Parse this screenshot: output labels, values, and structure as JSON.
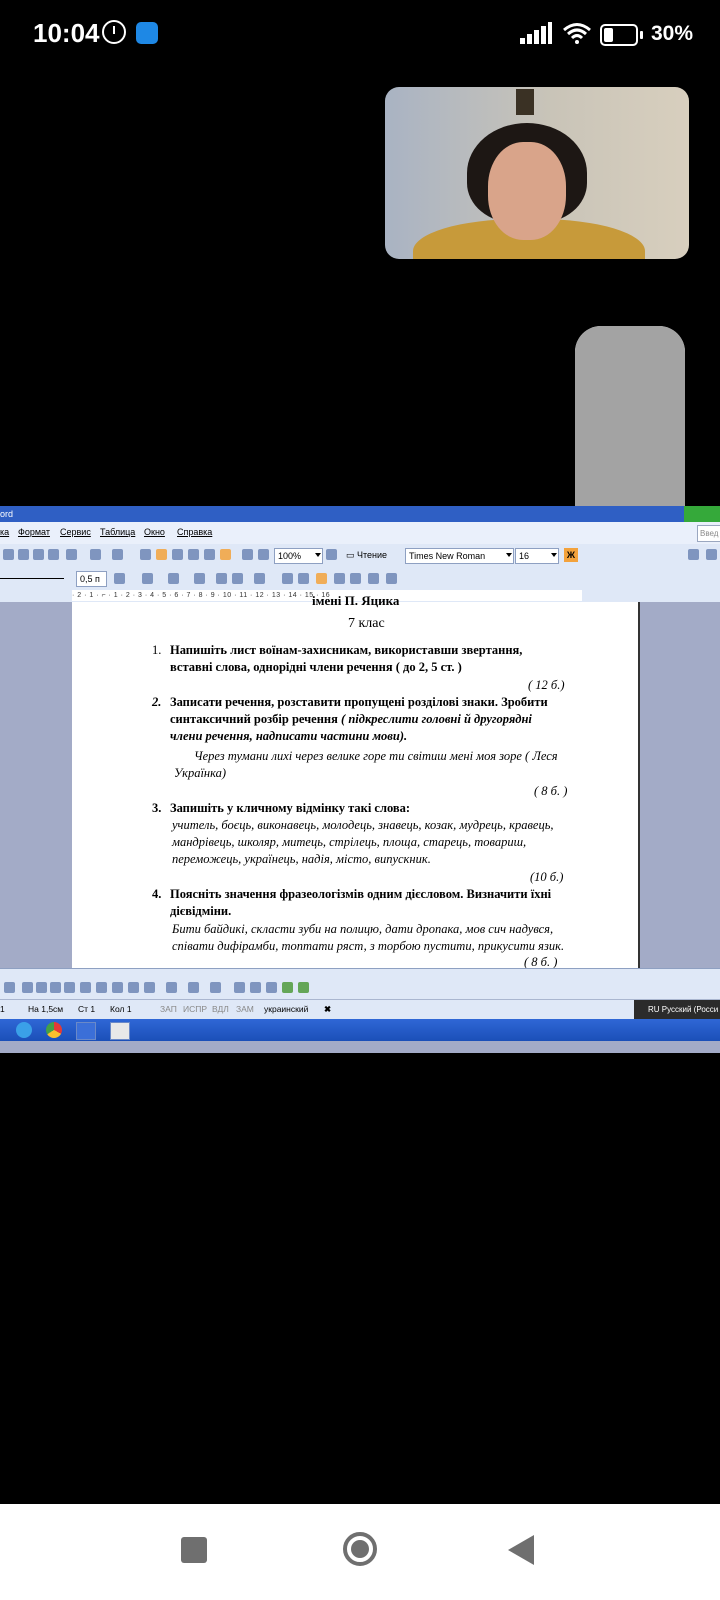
{
  "status_bar": {
    "time": "10:04",
    "battery_percent": "30%",
    "battery_level": 0.3
  },
  "volume_level": 0.27,
  "word": {
    "title": "ord",
    "menu": [
      "ка",
      "Формат",
      "Сервис",
      "Таблица",
      "Окно",
      "Справка"
    ],
    "search_placeholder": "Введ",
    "zoom": "100%",
    "read_label": "Чтение",
    "font": "Times New Roman",
    "font_size": "16",
    "bold_label": "Ж",
    "line_width": "0,5 п",
    "ruler": "· 2 · 1 · ⌐ · 1 · 2 · 3 · 4 · 5 · 6 · 7 · 8 · 9 · 10 · 11 · 12 · 13 · 14 · 15 · 16",
    "document": {
      "cutoff_title": "імені П. Яцика",
      "grade": "7 клас",
      "tasks": [
        {
          "num": "1.",
          "lines": [
            "Напишіть   лист воїнам-захисникам, використавши звертання,",
            "вставні слова, однорідні члени речення ( до  2, 5 ст. )"
          ],
          "score": "( 12 б.)"
        },
        {
          "num": "2.",
          "line1": "Записати речення, розставити пропущені розділові знаки. Зробити",
          "line2_bold": "синтаксичний  розбір  речення ",
          "line2_italic": "( підкреслити  головні й другорядні",
          "line3": "члени речення, надписати  частини мови).",
          "example": [
            "Через тумани лихі через  велике горе  ти  світиш мені  моя зоре ( Леся",
            "Українка)"
          ],
          "score": "( 8 б. )"
        },
        {
          "num": "3.",
          "lines": [
            "Запишіть  у кличному відмінку такі слова:"
          ],
          "words": [
            "учитель, боєць, виконавець, молодець, знавець, козак, мудрець, кравець,",
            "мандрівець, школяр, митець, стрілець, площа, старець, товариш,",
            "переможець, українець,  надія,  місто,  випускник."
          ],
          "score": "(10 б.)"
        },
        {
          "num": "4.",
          "lines": [
            "Поясніть значення  фразеологізмів одним  дієсловом.  Визначити їхні",
            "дієвідміни."
          ],
          "idioms": [
            "Бити байдикі, скласти зуби на полицю, дати дропака, мов сич надувся,",
            "співати дифірамби,  топтати ряст, з торбою пустити, прикусити язик."
          ],
          "score": "(  8 б. )"
        }
      ]
    },
    "status": {
      "page_pos": "1",
      "at": "На 1,5см",
      "line": "Ст 1",
      "col": "Кол 1",
      "rec": "ЗАП",
      "trk": "ИСПР",
      "ext": "ВДЛ",
      "ovr": "ЗАМ",
      "lang": "украинский",
      "langbar": "RU Русский (Росси"
    }
  },
  "colors": {
    "word_blue": "#2f5fc4",
    "toolbar": "#dfe8f7",
    "doc_bg": "#a3abc7"
  }
}
